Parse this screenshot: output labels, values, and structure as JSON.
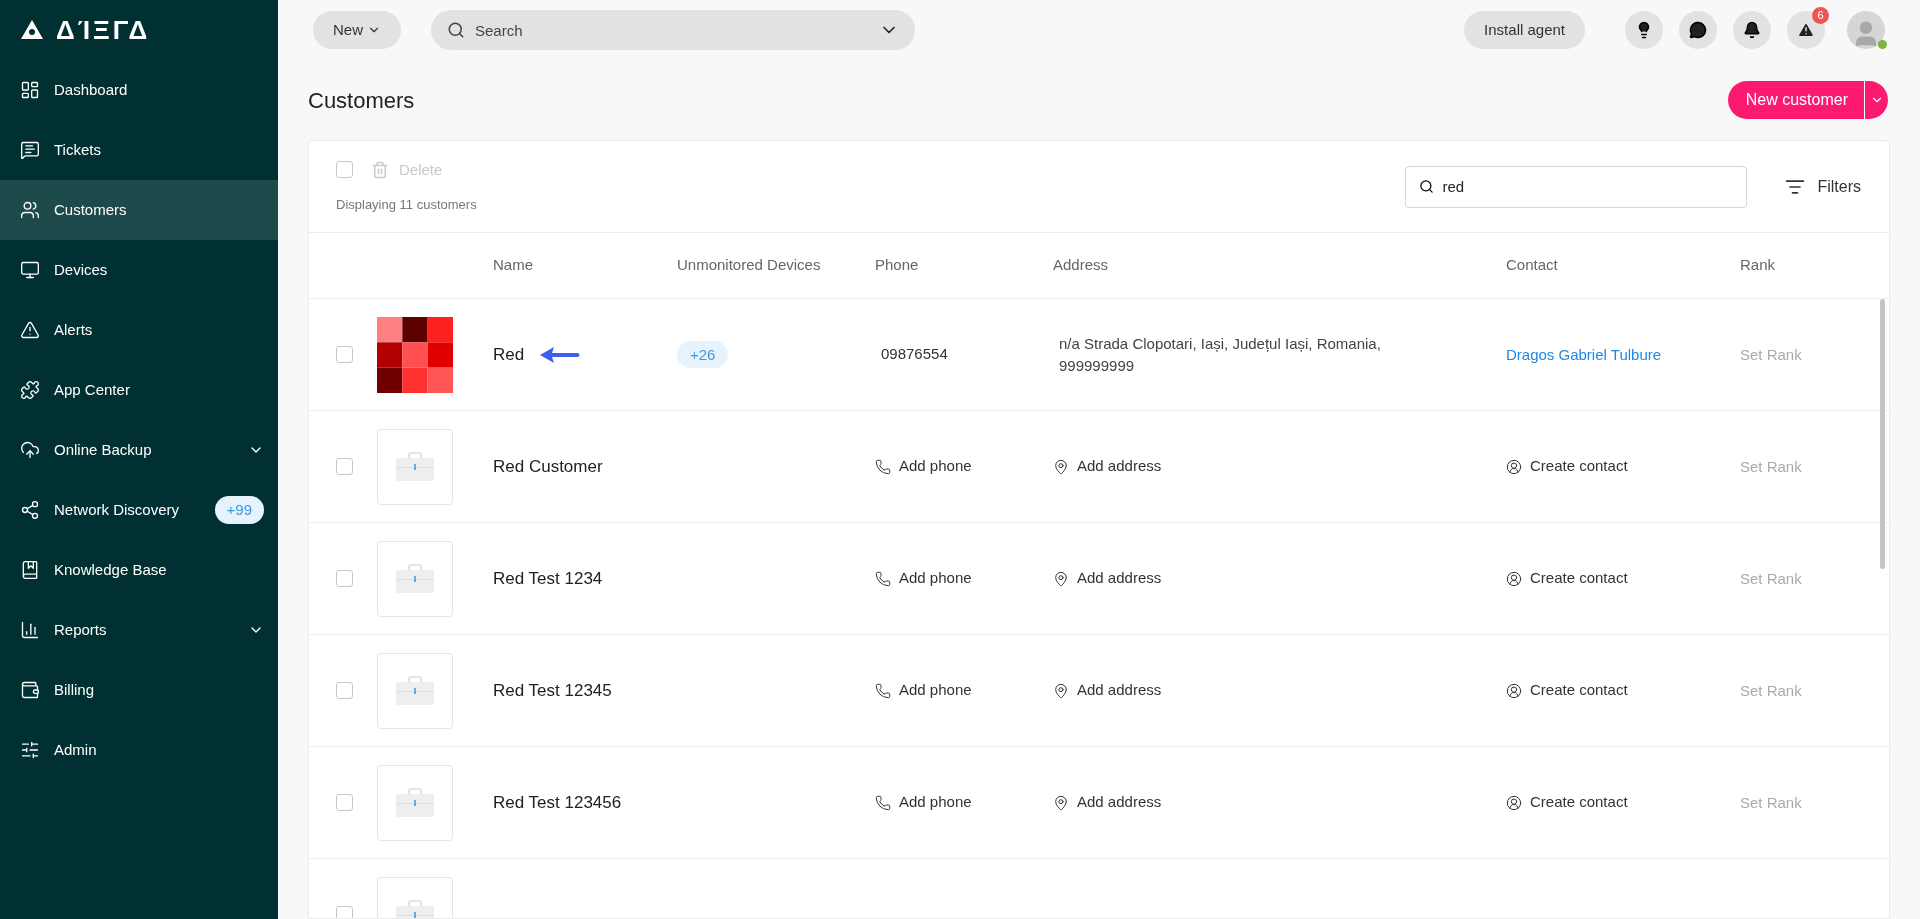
{
  "sidebar": {
    "logo": "ΔΊΞΓΔ",
    "items": [
      {
        "label": "Dashboard",
        "selected": false
      },
      {
        "label": "Tickets",
        "selected": false
      },
      {
        "label": "Customers",
        "selected": true
      },
      {
        "label": "Devices",
        "selected": false
      },
      {
        "label": "Alerts",
        "selected": false
      },
      {
        "label": "App Center",
        "selected": false
      },
      {
        "label": "Online Backup",
        "selected": false,
        "expandable": true
      },
      {
        "label": "Network Discovery",
        "selected": false,
        "badge": "+99"
      },
      {
        "label": "Knowledge Base",
        "selected": false
      },
      {
        "label": "Reports",
        "selected": false,
        "expandable": true
      },
      {
        "label": "Billing",
        "selected": false
      },
      {
        "label": "Admin",
        "selected": false
      }
    ]
  },
  "topbar": {
    "new_button": "New",
    "search": {
      "placeholder": "Search"
    },
    "install_button": "Install agent",
    "alerts_badge": "6"
  },
  "page": {
    "title": "Customers",
    "new_customer_button": "New customer"
  },
  "toolbar": {
    "select_all_checked": false,
    "delete_button": "Delete",
    "count": "Displaying 11 customers",
    "search": {
      "value": "red"
    },
    "filters_button": "Filters"
  },
  "table": {
    "columns": [
      "Name",
      "Unmonitored Devices",
      "Phone",
      "Address",
      "Contact",
      "Rank"
    ],
    "rows": [
      {
        "kind": "pixel",
        "name": "Red",
        "arrow": true,
        "unmonitored": "+26",
        "phone": {
          "kind": "value",
          "text": "09876554"
        },
        "address": {
          "kind": "value",
          "text": "n/a Strada Clopotari, Iași, Județul Iași, Romania, 999999999"
        },
        "contact": {
          "kind": "link",
          "text": "Dragos Gabriel Tulbure"
        },
        "rank": "Set Rank",
        "checked": false
      },
      {
        "kind": "briefcase",
        "name": "Red Customer",
        "phone": {
          "kind": "add",
          "text": "Add phone"
        },
        "address": {
          "kind": "add",
          "text": "Add address"
        },
        "contact": {
          "kind": "add",
          "text": "Create contact"
        },
        "rank": "Set Rank",
        "checked": false
      },
      {
        "kind": "briefcase",
        "name": "Red Test 1234",
        "phone": {
          "kind": "add",
          "text": "Add phone"
        },
        "address": {
          "kind": "add",
          "text": "Add address"
        },
        "contact": {
          "kind": "add",
          "text": "Create contact"
        },
        "rank": "Set Rank",
        "checked": false
      },
      {
        "kind": "briefcase",
        "name": "Red Test 12345",
        "phone": {
          "kind": "add",
          "text": "Add phone"
        },
        "address": {
          "kind": "add",
          "text": "Add address"
        },
        "contact": {
          "kind": "add",
          "text": "Create contact"
        },
        "rank": "Set Rank",
        "checked": false
      },
      {
        "kind": "briefcase",
        "name": "Red Test 123456",
        "phone": {
          "kind": "add",
          "text": "Add phone"
        },
        "address": {
          "kind": "add",
          "text": "Add address"
        },
        "contact": {
          "kind": "add",
          "text": "Create contact"
        },
        "rank": "Set Rank",
        "checked": false
      },
      {
        "kind": "briefcase",
        "checked": false
      }
    ]
  }
}
